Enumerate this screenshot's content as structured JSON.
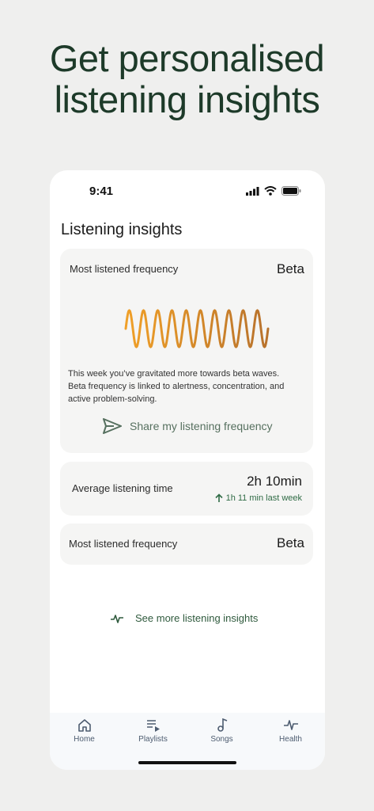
{
  "headline": {
    "line1": "Get personalised",
    "line2": "listening insights"
  },
  "status": {
    "time": "9:41"
  },
  "screen": {
    "title": "Listening insights"
  },
  "main_card": {
    "label": "Most listened frequency",
    "value": "Beta",
    "description": "This week you’ve gravitated more towards beta waves. Beta frequency is linked to alertness, concentration, and active problem-solving.",
    "share_label": "Share my listening frequency"
  },
  "avg_card": {
    "label": "Average listening time",
    "value": "2h 10min",
    "trend": "1h 11 min last week"
  },
  "freq_card": {
    "label": "Most listened frequency",
    "value": "Beta"
  },
  "see_more": {
    "label": "See more listening insights"
  },
  "nav": {
    "home": "Home",
    "playlists": "Playlists",
    "songs": "Songs",
    "health": "Health"
  },
  "colors": {
    "headline": "#1d3a29",
    "wave_start": "#f0a028",
    "wave_end": "#b8722c",
    "accent_green": "#2f6b45"
  }
}
